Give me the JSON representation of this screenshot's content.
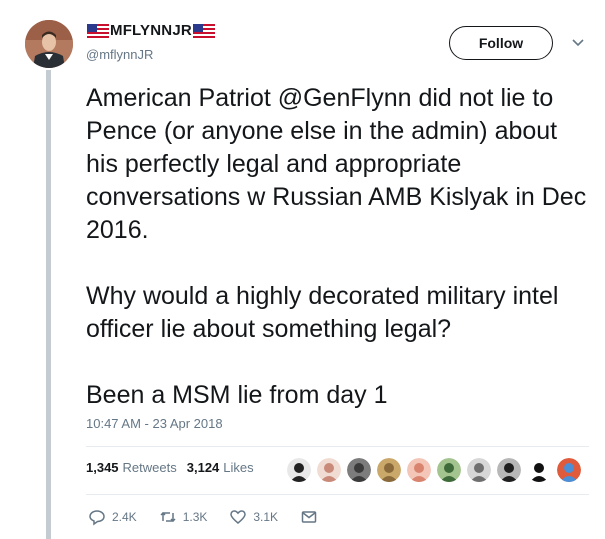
{
  "author": {
    "display_name": "MFLYNNJR",
    "handle": "@mflynnJR",
    "name_flags": [
      "us-flag-icon",
      "us-flag-icon"
    ]
  },
  "follow_label": "Follow",
  "tweet": {
    "paragraphs": [
      "American Patriot @GenFlynn did not lie to Pence (or anyone else in the admin) about his perfectly legal and appropriate conversations w Russian AMB Kislyak in Dec 2016.",
      "Why would a highly decorated military intel officer lie about something legal?",
      "Been a MSM lie from day 1"
    ],
    "timestamp": "10:47 AM - 23 Apr 2018"
  },
  "stats": {
    "retweets_count": "1,345",
    "retweets_label": "Retweets",
    "likes_count": "3,124",
    "likes_label": "Likes"
  },
  "liker_avatars": [
    {
      "fg": "#222222",
      "bg": "#e8e8e8"
    },
    {
      "fg": "#c98a7a",
      "bg": "#f1dcd3"
    },
    {
      "fg": "#3b3b3b",
      "bg": "#7c7c7c"
    },
    {
      "fg": "#8a6a3a",
      "bg": "#c9a86a"
    },
    {
      "fg": "#d9846f",
      "bg": "#f3c6b8"
    },
    {
      "fg": "#3f6a3a",
      "bg": "#a4c48f"
    },
    {
      "fg": "#6f6f6f",
      "bg": "#d7d7d7"
    },
    {
      "fg": "#1f1f1f",
      "bg": "#b7b7b7"
    },
    {
      "fg": "#111111",
      "bg": "#ffffff"
    },
    {
      "fg": "#4b8fd6",
      "bg": "#e05a3c"
    }
  ],
  "actions": {
    "replies": "2.4K",
    "retweets": "1.3K",
    "likes": "3.1K"
  },
  "colors": {
    "text": "#14171a",
    "secondary": "#657786",
    "thread_line": "#c4ccd2",
    "divider": "#e6ecf0"
  }
}
